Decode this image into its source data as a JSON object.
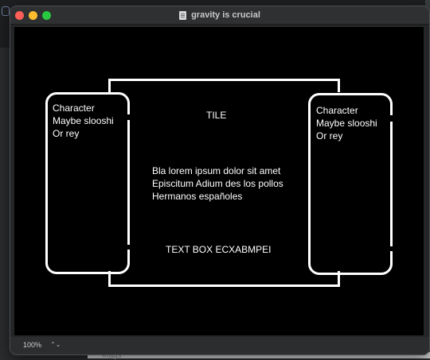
{
  "window": {
    "title": "gravity is crucial"
  },
  "status": {
    "zoom": "100%",
    "zoom_arrow": "⌃⌄"
  },
  "canvas": {
    "left_panel": {
      "line1": "Character",
      "line2": "Maybe slooshi",
      "line3": "Or rey"
    },
    "right_panel": {
      "line1": "Character",
      "line2": "Maybe slooshi",
      "line3": "Or rey"
    },
    "tile": "TILE",
    "paragraph": {
      "line1": "Bla lorem ipsum dolor sit amet",
      "line2": "Episcitum Adium des los pollos",
      "line3": "Hermanos españoles"
    },
    "text_box": "TEXT BOX ECXABMPEI"
  },
  "background": {
    "bottom_text": "#tags"
  },
  "colors": {
    "close": "#ff5f57",
    "minimize": "#febc2e",
    "maximize": "#28c840",
    "canvas_bg": "#000000",
    "stroke": "#ffffff"
  }
}
